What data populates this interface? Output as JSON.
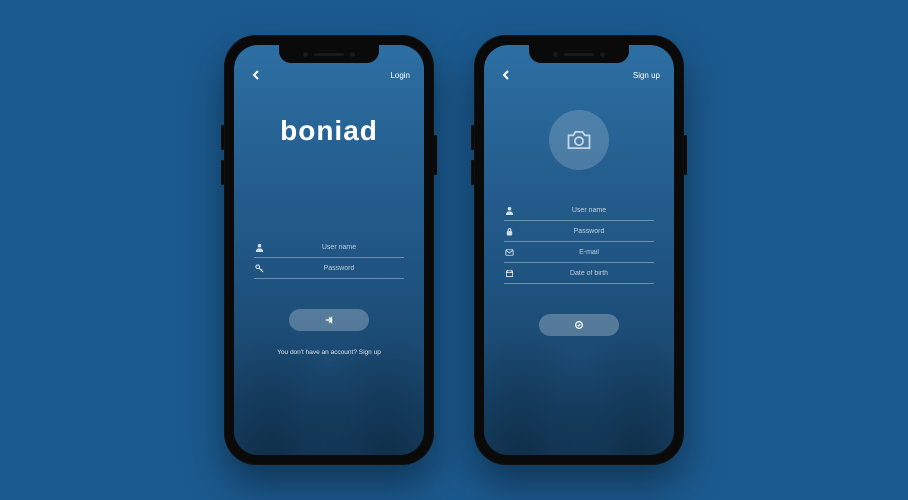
{
  "brand": "boniad",
  "login_screen": {
    "top_link": "Login",
    "fields": {
      "username_placeholder": "User name",
      "password_placeholder": "Password"
    },
    "footer": "You don't have an account? Sign up"
  },
  "signup_screen": {
    "top_link": "Sign up",
    "fields": {
      "username_placeholder": "User name",
      "password_placeholder": "Password",
      "email_placeholder": "E-mail",
      "dob_placeholder": "Date of birth"
    }
  },
  "colors": {
    "background": "#1b5a8f",
    "screen_top": "#2d6fa3",
    "screen_bottom": "#1c4d78",
    "accent_overlay": "rgba(255,255,255,0.25)"
  }
}
